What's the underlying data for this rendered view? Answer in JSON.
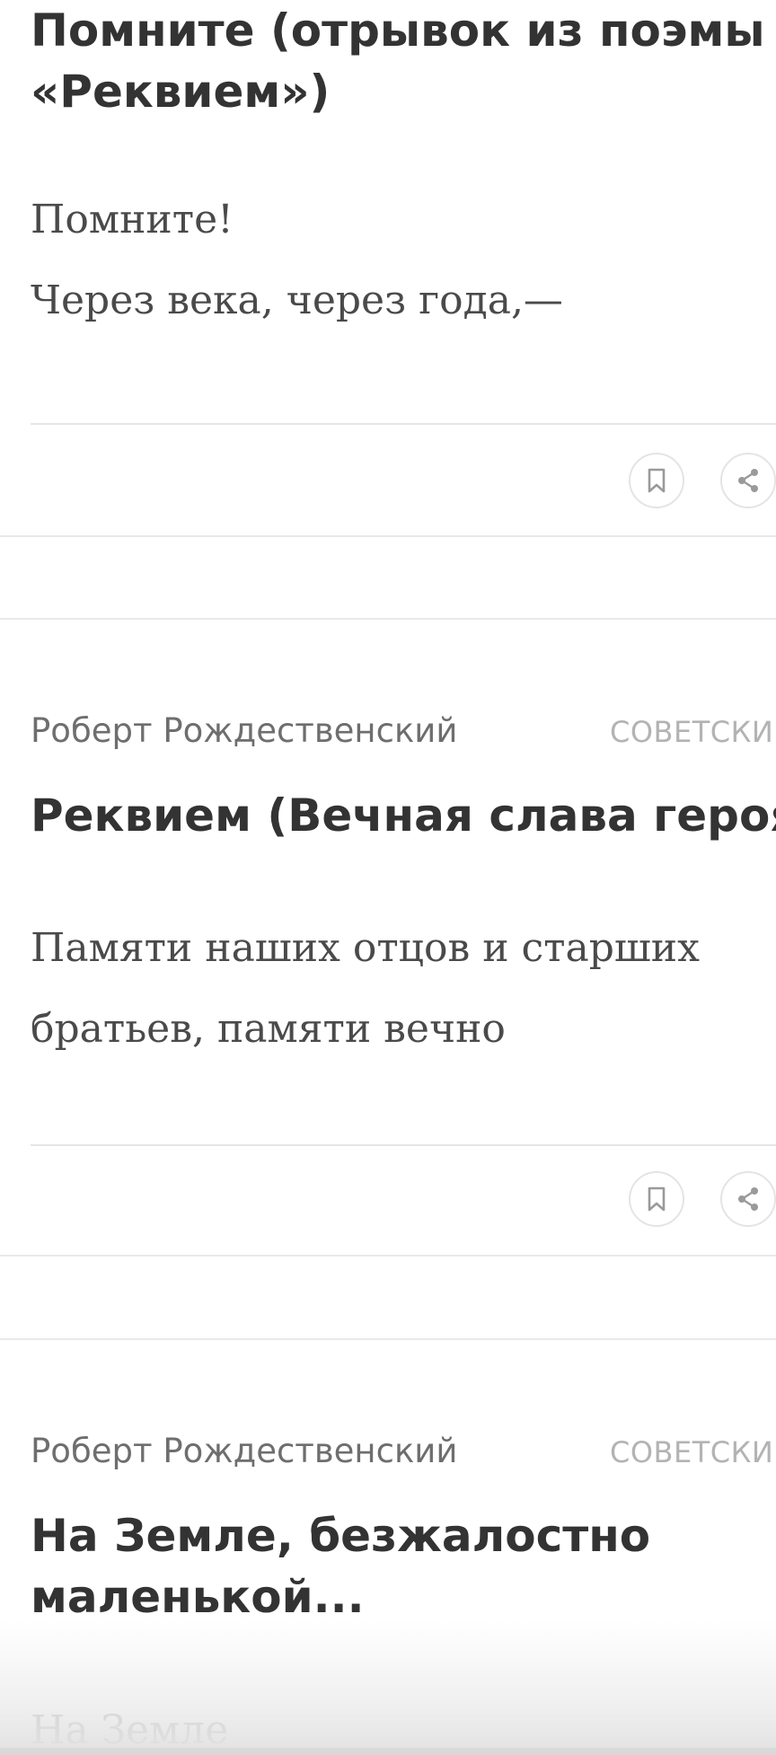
{
  "feed": {
    "cards": [
      {
        "title_lines": [
          "Помните (отрывок из поэмы",
          "«Реквием»)"
        ],
        "excerpt_lines": [
          "Помните!",
          "Через века, через года,—"
        ]
      },
      {
        "author": "Роберт Рождественский",
        "category": "СОВЕТСКИЕ",
        "title_lines": [
          "Реквием (Вечная слава героям)"
        ],
        "excerpt_lines": [
          "Памяти наших отцов и старших",
          "братьев, памяти вечно"
        ]
      },
      {
        "author": "Роберт Рождественский",
        "category": "СОВЕТСКИЕ",
        "title_lines": [
          "На Земле, безжалостно",
          "маленькой..."
        ],
        "excerpt_lines": [
          "На Земле"
        ]
      }
    ]
  },
  "icons": {
    "bookmark": "bookmark-icon",
    "share": "share-icon"
  },
  "colors": {
    "title": "#333333",
    "author": "#6e6e6e",
    "category": "#b3b3b3",
    "excerpt": "#4a4a4a",
    "divider": "#e6e6e6"
  }
}
